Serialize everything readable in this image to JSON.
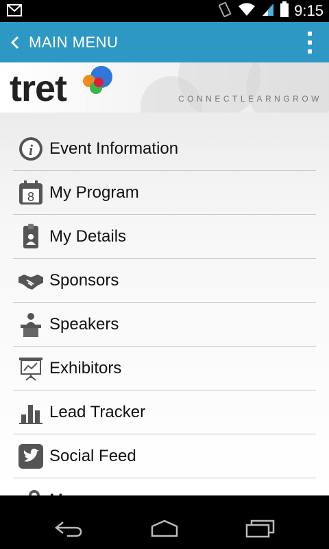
{
  "status_bar": {
    "time": "9:15",
    "icons": [
      "gmail-icon",
      "vibrate-icon",
      "wifi-icon",
      "signal-icon",
      "battery-icon"
    ]
  },
  "action_bar": {
    "title": "MAIN MENU",
    "color": "#2e98c4"
  },
  "banner": {
    "logo": "tret",
    "tagline": "CONNECTLEARNGROW"
  },
  "menu": {
    "items": [
      {
        "label": "Event Information",
        "icon": "info-icon"
      },
      {
        "label": "My Program",
        "icon": "calendar-icon"
      },
      {
        "label": "My Details",
        "icon": "badge-icon"
      },
      {
        "label": "Sponsors",
        "icon": "handshake-icon"
      },
      {
        "label": "Speakers",
        "icon": "podium-icon"
      },
      {
        "label": "Exhibitors",
        "icon": "presentation-icon"
      },
      {
        "label": "Lead Tracker",
        "icon": "bar-chart-icon"
      },
      {
        "label": "Social Feed",
        "icon": "twitter-icon"
      },
      {
        "label": "M",
        "icon": "map-icon"
      }
    ]
  },
  "nav_bar": {
    "buttons": [
      "back-icon",
      "home-icon",
      "recents-icon"
    ]
  }
}
